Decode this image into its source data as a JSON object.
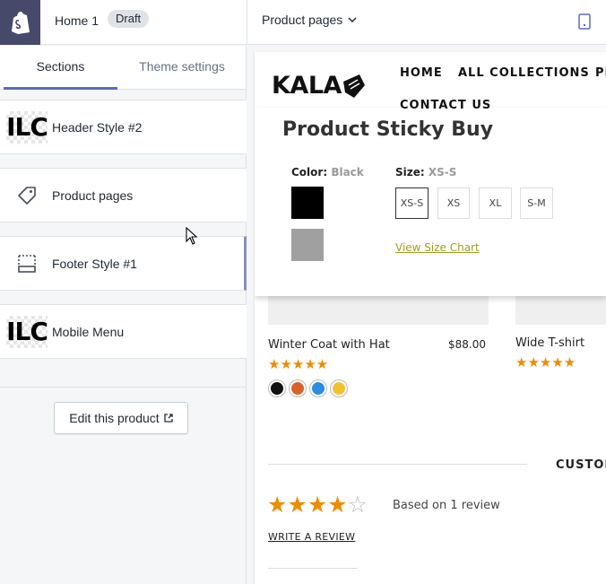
{
  "topbar": {
    "title": "Home 1",
    "badge": "Draft",
    "page_select": "Product pages"
  },
  "sidebar": {
    "tabs": [
      {
        "label": "Sections"
      },
      {
        "label": "Theme settings"
      }
    ],
    "sections": [
      {
        "label": "Header Style #2",
        "thumb": "ILC"
      },
      {
        "label": "Product pages"
      },
      {
        "label": "Footer Style #1"
      },
      {
        "label": "Mobile Menu",
        "thumb": "ILC"
      }
    ],
    "edit_button": "Edit this product"
  },
  "preview": {
    "logo": "KALA",
    "nav": [
      "HOME",
      "ALL COLLECTIONS",
      "PR",
      "CONTACT US"
    ],
    "sticky": {
      "title": "Product Sticky Buy",
      "color_label": "Color:",
      "color_value": "Black",
      "size_label": "Size:",
      "size_value": "XS-S",
      "colors": [
        "#000000",
        "#a0a0a0"
      ],
      "sizes": [
        "XS-S",
        "XS",
        "XL",
        "S-M"
      ],
      "size_chart_link": "View Size Chart"
    },
    "products": [
      {
        "name": "Winter Coat with Hat",
        "price": "$88.00",
        "stars": "★★★★★",
        "colors": [
          "#111111",
          "#d9622b",
          "#2b8de0",
          "#f2c22e"
        ]
      },
      {
        "name": "Wide T-shirt",
        "price": "",
        "stars": "★★★★★"
      }
    ],
    "custom_label": "CUSTOM",
    "review": {
      "stars_full": "★★★★",
      "stars_empty": "☆",
      "based_on": "Based on 1 review",
      "write_link": "WRITE A REVIEW"
    }
  }
}
